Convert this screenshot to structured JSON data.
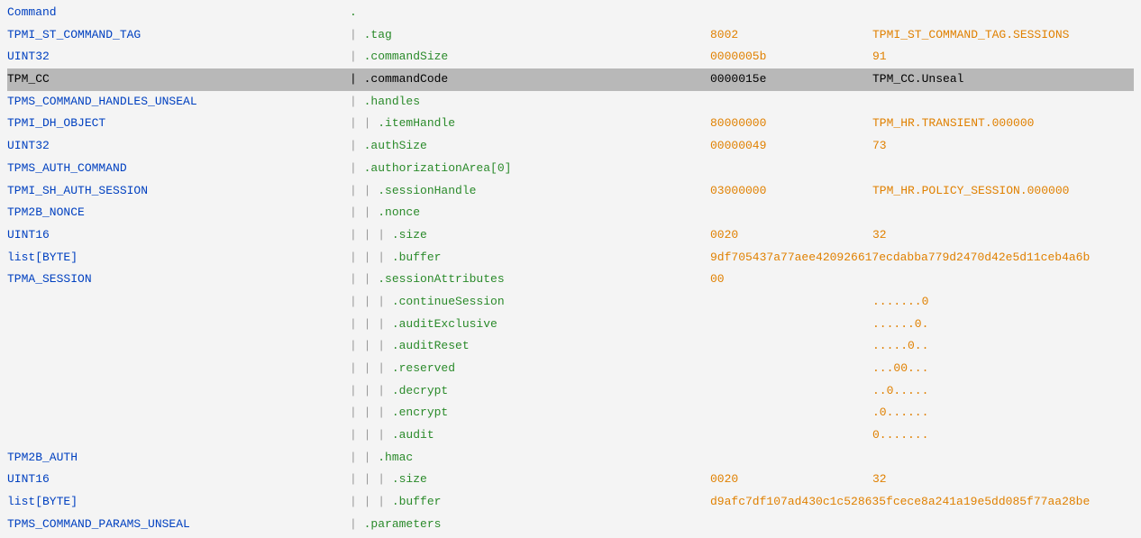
{
  "rows": [
    {
      "type": "Command",
      "indent": 0,
      "field": ".",
      "hex": "",
      "decoded": "",
      "selected": false,
      "noPipe": true
    },
    {
      "type": "TPMI_ST_COMMAND_TAG",
      "indent": 0,
      "field": ".tag",
      "hex": "8002",
      "decoded": "TPMI_ST_COMMAND_TAG.SESSIONS",
      "selected": false
    },
    {
      "type": "UINT32",
      "indent": 0,
      "field": ".commandSize",
      "hex": "0000005b",
      "decoded": "91",
      "selected": false
    },
    {
      "type": "TPM_CC",
      "indent": 0,
      "field": ".commandCode",
      "hex": "0000015e",
      "decoded": "TPM_CC.Unseal",
      "selected": true
    },
    {
      "type": "TPMS_COMMAND_HANDLES_UNSEAL",
      "indent": 0,
      "field": ".handles",
      "hex": "",
      "decoded": "",
      "selected": false
    },
    {
      "type": "TPMI_DH_OBJECT",
      "indent": 1,
      "field": ".itemHandle",
      "hex": "80000000",
      "decoded": "TPM_HR.TRANSIENT.000000",
      "selected": false
    },
    {
      "type": "UINT32",
      "indent": 0,
      "field": ".authSize",
      "hex": "00000049",
      "decoded": "73",
      "selected": false
    },
    {
      "type": "TPMS_AUTH_COMMAND",
      "indent": 0,
      "field": ".authorizationArea[0]",
      "hex": "",
      "decoded": "",
      "selected": false
    },
    {
      "type": "TPMI_SH_AUTH_SESSION",
      "indent": 1,
      "field": ".sessionHandle",
      "hex": "03000000",
      "decoded": "TPM_HR.POLICY_SESSION.000000",
      "selected": false
    },
    {
      "type": "TPM2B_NONCE",
      "indent": 1,
      "field": ".nonce",
      "hex": "",
      "decoded": "",
      "selected": false
    },
    {
      "type": "UINT16",
      "indent": 2,
      "field": ".size",
      "hex": "0020",
      "decoded": "32",
      "selected": false
    },
    {
      "type": "list[BYTE]",
      "indent": 2,
      "field": ".buffer",
      "hex": "9df705437a77aee420926617ecdabba779d2470d42e5d11ceb4a6b",
      "decoded": "",
      "selected": false,
      "hexWide": true
    },
    {
      "type": "TPMA_SESSION",
      "indent": 1,
      "field": ".sessionAttributes",
      "hex": "00",
      "decoded": "",
      "selected": false
    },
    {
      "type": "",
      "indent": 2,
      "field": ".continueSession",
      "hex": "",
      "decoded": ".......0",
      "selected": false
    },
    {
      "type": "",
      "indent": 2,
      "field": ".auditExclusive",
      "hex": "",
      "decoded": "......0.",
      "selected": false
    },
    {
      "type": "",
      "indent": 2,
      "field": ".auditReset",
      "hex": "",
      "decoded": ".....0..",
      "selected": false
    },
    {
      "type": "",
      "indent": 2,
      "field": ".reserved",
      "hex": "",
      "decoded": "...00...",
      "selected": false
    },
    {
      "type": "",
      "indent": 2,
      "field": ".decrypt",
      "hex": "",
      "decoded": "..0.....",
      "selected": false
    },
    {
      "type": "",
      "indent": 2,
      "field": ".encrypt",
      "hex": "",
      "decoded": ".0......",
      "selected": false
    },
    {
      "type": "",
      "indent": 2,
      "field": ".audit",
      "hex": "",
      "decoded": "0.......",
      "selected": false
    },
    {
      "type": "TPM2B_AUTH",
      "indent": 1,
      "field": ".hmac",
      "hex": "",
      "decoded": "",
      "selected": false
    },
    {
      "type": "UINT16",
      "indent": 2,
      "field": ".size",
      "hex": "0020",
      "decoded": "32",
      "selected": false
    },
    {
      "type": "list[BYTE]",
      "indent": 2,
      "field": ".buffer",
      "hex": "d9afc7df107ad430c1c528635fcece8a241a19e5dd085f77aa28be",
      "decoded": "",
      "selected": false,
      "hexWide": true
    },
    {
      "type": "TPMS_COMMAND_PARAMS_UNSEAL",
      "indent": 0,
      "field": ".parameters",
      "hex": "",
      "decoded": "",
      "selected": false
    }
  ]
}
